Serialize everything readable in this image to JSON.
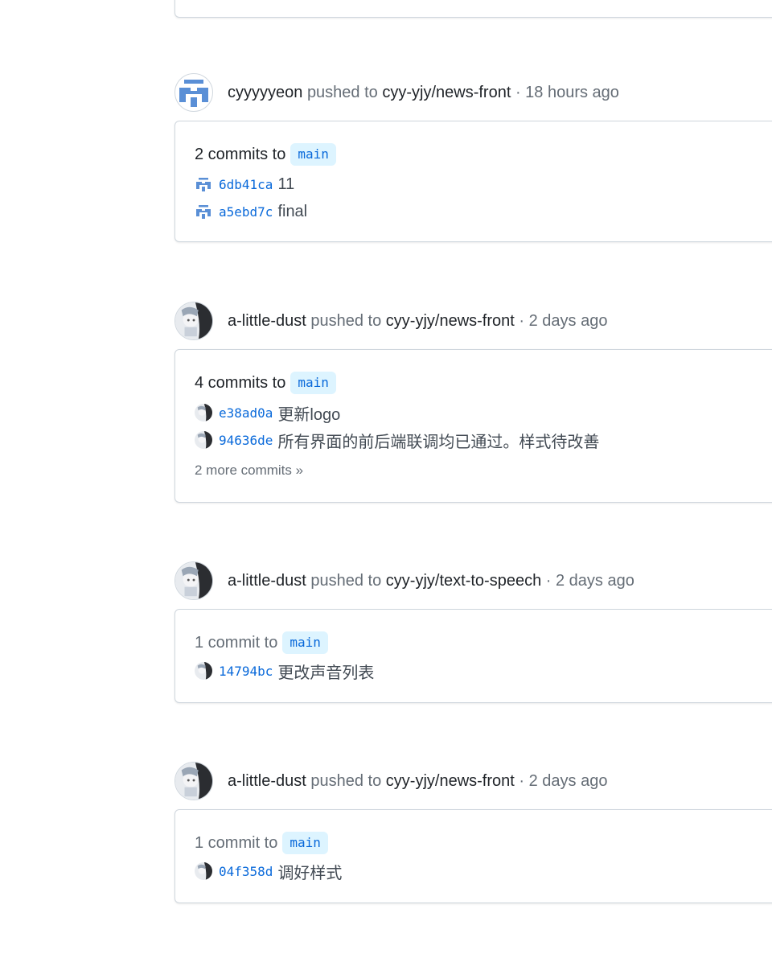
{
  "events": [
    {
      "actor": "cyyyyyeon",
      "action": "pushed to",
      "repo": "cyy-yjy/news-front",
      "time": "· 18 hours ago",
      "avatar_icon": "identicon-icon",
      "summary": "2 commits to",
      "branch": "main",
      "commits": [
        {
          "sha": "6db41ca",
          "message": "11",
          "avatar_icon": "identicon-icon"
        },
        {
          "sha": "a5ebd7c",
          "message": "final",
          "avatar_icon": "identicon-icon"
        }
      ],
      "more": ""
    },
    {
      "actor": "a-little-dust",
      "action": "pushed to",
      "repo": "cyy-yjy/news-front",
      "time": "· 2 days ago",
      "avatar_icon": "anime-avatar-icon",
      "summary": "4 commits to",
      "branch": "main",
      "commits": [
        {
          "sha": "e38ad0a",
          "message": "更新logo",
          "avatar_icon": "anime-avatar-icon"
        },
        {
          "sha": "94636de",
          "message": "所有界面的前后端联调均已通过。样式待改善",
          "avatar_icon": "anime-avatar-icon"
        }
      ],
      "more": "2 more commits »"
    },
    {
      "actor": "a-little-dust",
      "action": "pushed to",
      "repo": "cyy-yjy/text-to-speech",
      "time": "· 2 days ago",
      "avatar_icon": "anime-avatar-icon",
      "summary": "1 commit to",
      "branch": "main",
      "commits": [
        {
          "sha": "14794bc",
          "message": "更改声音列表",
          "avatar_icon": "anime-avatar-icon"
        }
      ],
      "more": ""
    },
    {
      "actor": "a-little-dust",
      "action": "pushed to",
      "repo": "cyy-yjy/news-front",
      "time": "· 2 days ago",
      "avatar_icon": "anime-avatar-icon",
      "summary": "1 commit to",
      "branch": "main",
      "commits": [
        {
          "sha": "04f358d",
          "message": "调好样式",
          "avatar_icon": "anime-avatar-icon"
        }
      ],
      "more": ""
    }
  ],
  "colors": {
    "link": "#0969da",
    "branch_bg": "#ddf4ff",
    "muted": "#656d76",
    "border": "#d0d7de",
    "identicon": "#5a8fd6"
  }
}
